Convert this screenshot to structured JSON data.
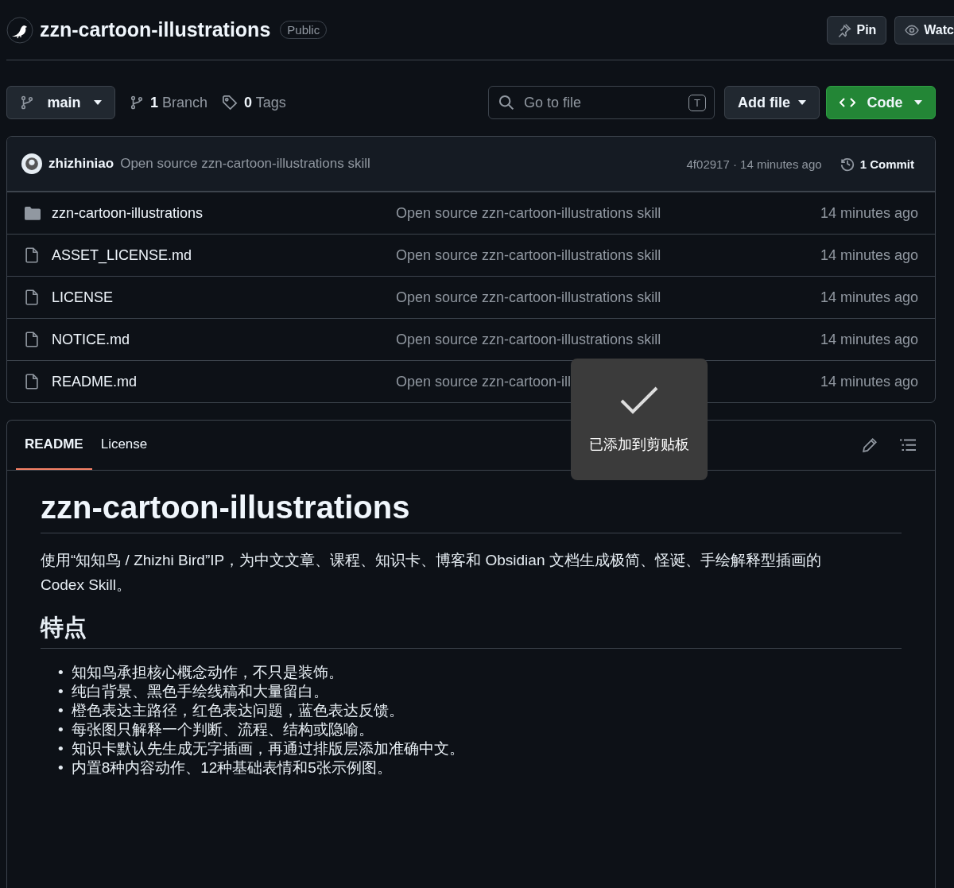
{
  "repo": {
    "name": "zzn-cartoon-illustrations",
    "visibility": "Public"
  },
  "header_buttons": [
    {
      "kind": "pin",
      "label": "Pin"
    },
    {
      "kind": "watch",
      "label": "Watc"
    }
  ],
  "toolbar": {
    "branch": "main",
    "branches": "**1** Branch",
    "tags": "**0** Tags",
    "search": {
      "placeholder": "Go to file",
      "shortcut": "T"
    },
    "add_file": "Add file",
    "code": "Code"
  },
  "latest_commit": {
    "author": "zhizhiniao",
    "message": "Open source zzn-cartoon-illustrations skill",
    "hash_time": "4f02917 · 14 minutes ago",
    "commits": "1 Commit"
  },
  "files": [
    {
      "kind": "folder",
      "name": "zzn-cartoon-illustrations",
      "message": "Open source zzn-cartoon-illustrations skill",
      "time": "14 minutes ago"
    },
    {
      "kind": "file",
      "name": "ASSET_LICENSE.md",
      "message": "Open source zzn-cartoon-illustrations skill",
      "time": "14 minutes ago"
    },
    {
      "kind": "file",
      "name": "LICENSE",
      "message": "Open source zzn-cartoon-illustrations skill",
      "time": "14 minutes ago"
    },
    {
      "kind": "file",
      "name": "NOTICE.md",
      "message": "Open source zzn-cartoon-illustrations skill",
      "time": "14 minutes ago"
    },
    {
      "kind": "file",
      "name": "README.md",
      "message": "Open source zzn-cartoon-ill",
      "time": "14 minutes ago"
    }
  ],
  "readme": {
    "tabs": [
      {
        "label": "README",
        "selected": true
      },
      {
        "label": "License",
        "selected": false
      }
    ],
    "title": "zzn-cartoon-illustrations",
    "intro": "使用“知知鸟 / Zhizhi Bird”IP，为中文文章、课程、知识卡、博客和 Obsidian 文档生成极简、怪诞、手绘解释型插画的 Codex Skill。",
    "sections": [
      {
        "heading": "特点",
        "bullet": "•",
        "items": [
          "知知鸟承担核心概念动作，不只是装饰。",
          "纯白背景、黑色手绘线稿和大量留白。",
          "橙色表达主路径，红色表达问题，蓝色表达反馈。",
          "每张图只解释一个判断、流程、结构或隐喻。",
          "知识卡默认先生成无字插画，再通过排版层添加准确中文。",
          "内置8种内容动作、12种基础表情和5张示例图。"
        ]
      }
    ]
  },
  "toast": {
    "message": "已添加到剪贴板"
  }
}
